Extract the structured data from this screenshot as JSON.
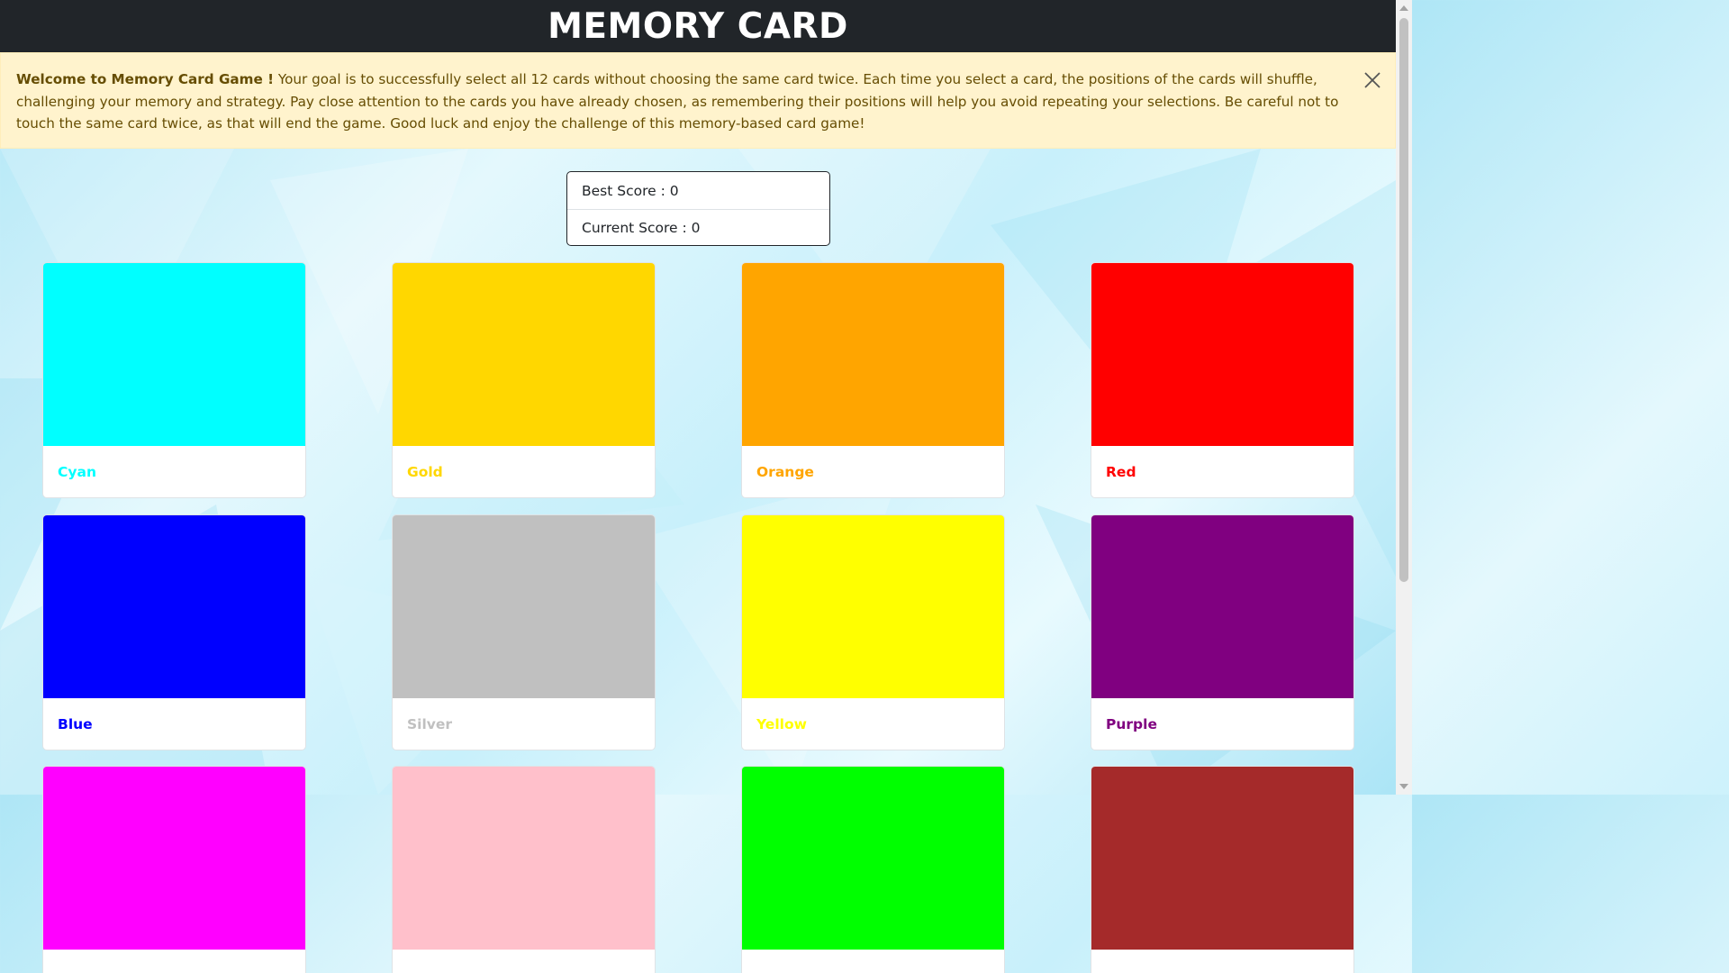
{
  "header": {
    "title": "MEMORY CARD"
  },
  "alert": {
    "strong": "Welcome to Memory Card Game !",
    "message": " Your goal is to successfully select all 12 cards without choosing the same card twice. Each time you select a card, the positions of the cards will shuffle, challenging your memory and strategy. Pay close attention to the cards you have already chosen, as remembering their positions will help you avoid repeating your selections. Be careful not to touch the same card twice, as that will end the game. Good luck and enjoy the challenge of this memory-based card game!",
    "close_icon": "close-icon"
  },
  "scores": {
    "best": "Best Score : 0",
    "current": "Current Score : 0"
  },
  "cards": [
    {
      "label": "Cyan",
      "color": "#00ffff"
    },
    {
      "label": "Gold",
      "color": "#ffd700"
    },
    {
      "label": "Orange",
      "color": "#ffa500"
    },
    {
      "label": "Red",
      "color": "#ff0000"
    },
    {
      "label": "Blue",
      "color": "#0000ff"
    },
    {
      "label": "Silver",
      "color": "#c0c0c0"
    },
    {
      "label": "Yellow",
      "color": "#ffff00"
    },
    {
      "label": "Purple",
      "color": "#800080"
    },
    {
      "label": "",
      "color": "#ff00ff"
    },
    {
      "label": "",
      "color": "#ffc0cb"
    },
    {
      "label": "",
      "color": "#00ff00"
    },
    {
      "label": "",
      "color": "#a52a2a"
    }
  ]
}
